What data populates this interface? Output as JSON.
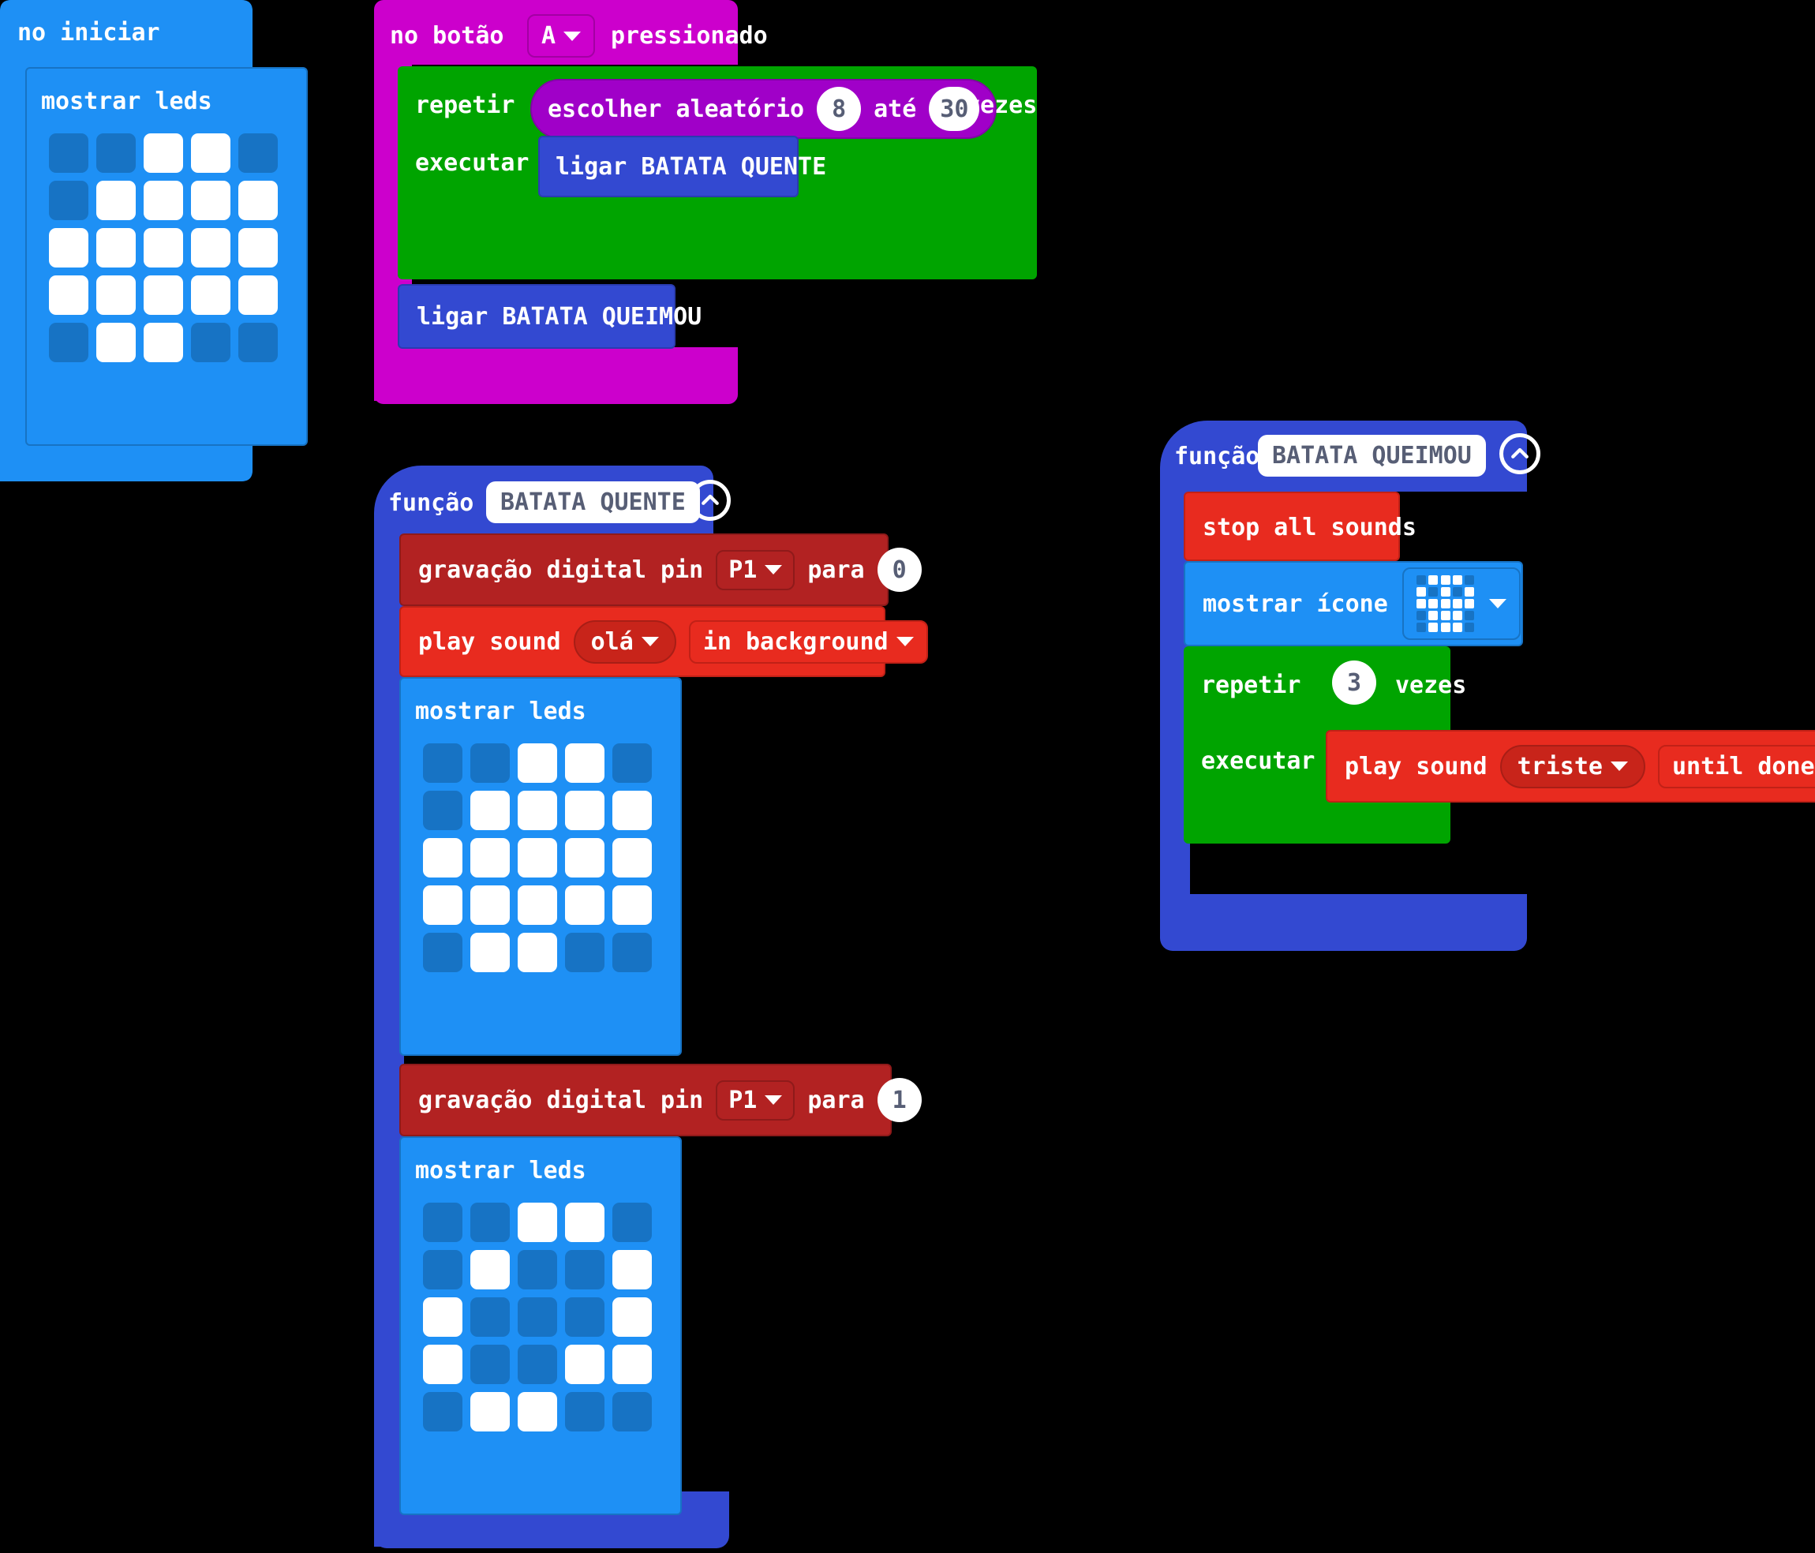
{
  "colors": {
    "background": "#000000",
    "basic_blue": "#1e90f5",
    "basic_blue_dark": "#1773c4",
    "loop_green": "#00a400",
    "event_magenta": "#cc00cc",
    "math_purple": "#a000c8",
    "function_blue": "#3349d1",
    "pins_dark_red": "#b22222",
    "music_red": "#e82b1f",
    "led_on": "#ffffff",
    "led_off": "#1773c4",
    "field_text": "#575e75"
  },
  "blocks": {
    "on_start": {
      "header_label": "no iniciar",
      "show_leds": {
        "label": "mostrar leds",
        "grid": [
          [
            0,
            0,
            1,
            1,
            0
          ],
          [
            0,
            1,
            1,
            1,
            1
          ],
          [
            1,
            1,
            1,
            1,
            1
          ],
          [
            1,
            1,
            1,
            1,
            1
          ],
          [
            0,
            1,
            1,
            0,
            0
          ]
        ]
      }
    },
    "on_button": {
      "prefix_label": "no botão",
      "button_value": "A",
      "suffix_label": "pressionado",
      "repeat": {
        "repeat_label": "repetir",
        "do_label": "executar",
        "times_label": "vezes",
        "random": {
          "label": "escolher aleatório",
          "from": "8",
          "until_label": "até",
          "to": "30"
        },
        "body_call": "ligar BATATA QUENTE"
      },
      "after_call": "ligar BATATA QUEIMOU"
    },
    "function_quente": {
      "keyword": "função",
      "name": "BATATA QUENTE",
      "collapse_icon": "chevron-up-circle-icon",
      "digital_write_0": {
        "prefix": "gravação digital pin",
        "pin": "P1",
        "mid": "para",
        "value": "0"
      },
      "play_sound": {
        "prefix": "play sound",
        "sound": "olá",
        "mode": "in background"
      },
      "show_leds_1": {
        "label": "mostrar leds",
        "grid": [
          [
            0,
            0,
            1,
            1,
            0
          ],
          [
            0,
            1,
            1,
            1,
            1
          ],
          [
            1,
            1,
            1,
            1,
            1
          ],
          [
            1,
            1,
            1,
            1,
            1
          ],
          [
            0,
            1,
            1,
            0,
            0
          ]
        ]
      },
      "digital_write_1": {
        "prefix": "gravação digital pin",
        "pin": "P1",
        "mid": "para",
        "value": "1"
      },
      "show_leds_2": {
        "label": "mostrar leds",
        "grid": [
          [
            0,
            0,
            1,
            1,
            0
          ],
          [
            0,
            1,
            0,
            0,
            1
          ],
          [
            1,
            0,
            0,
            0,
            1
          ],
          [
            1,
            0,
            0,
            1,
            1
          ],
          [
            0,
            1,
            1,
            0,
            0
          ]
        ]
      }
    },
    "function_queimou": {
      "keyword": "função",
      "name": "BATATA QUEIMOU",
      "collapse_icon": "chevron-up-circle-icon",
      "stop_all_sounds": "stop all sounds",
      "show_icon": {
        "label": "mostrar ícone",
        "icon_name": "sad-face-icon",
        "icon_grid": [
          [
            0,
            1,
            1,
            1,
            0
          ],
          [
            1,
            0,
            1,
            0,
            1
          ],
          [
            1,
            1,
            1,
            1,
            1
          ],
          [
            0,
            1,
            1,
            1,
            0
          ],
          [
            0,
            1,
            1,
            1,
            0
          ]
        ]
      },
      "repeat": {
        "repeat_label": "repetir",
        "times": "3",
        "times_label": "vezes",
        "do_label": "executar",
        "play_sound": {
          "prefix": "play sound",
          "sound": "triste",
          "mode": "until done"
        }
      }
    }
  }
}
